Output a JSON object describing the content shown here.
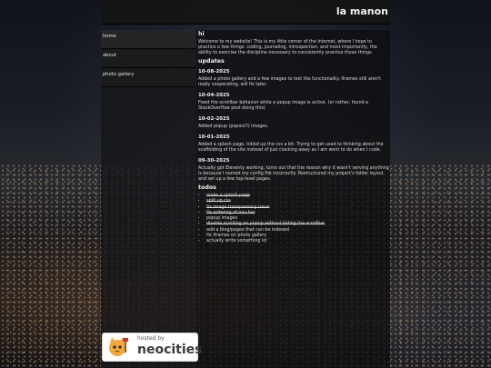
{
  "site": {
    "title": "la manon"
  },
  "nav": [
    {
      "label": "home"
    },
    {
      "label": "about"
    },
    {
      "label": "photo gallery"
    }
  ],
  "main": {
    "heading": "hi",
    "intro": "Welcome to my website! This is my little corner of the Internet, where I hope to practice a few things: coding, journaling, introspection, and most importantly, the ability to exercise the discipline necessary to consistently practice those things.",
    "updates_heading": "updates",
    "updates": [
      {
        "date": "10-08-2025",
        "text": "Added a photo gallery and a few images to test the functionality. Iframes still aren't really cooperating, will fix later."
      },
      {
        "date": "10-04-2025",
        "text": "Fixed the scrollbar behavior while a popup image is active. (or rather, found a StackOverflow post doing this)"
      },
      {
        "date": "10-02-2025",
        "text": "Added popup (popout?) images."
      },
      {
        "date": "10-01-2025",
        "text": "Added a splash page, tidied up the css a bit. Trying to get used to thinking about the scaffolding of the site instead of just clacking away as I am wont to do when I code."
      },
      {
        "date": "09-30-2025",
        "text": "Actually got Eleventy working, turns out that the reason why it wasn't serving anything is because I named my config file incorrectly. Restructured my project's folder layout and set up a few top-level pages."
      }
    ],
    "todos_heading": "todos",
    "todos": [
      {
        "text": "make a splash page",
        "done": true
      },
      {
        "text": "split up css",
        "done": true
      },
      {
        "text": "fix image transparency issue",
        "done": true
      },
      {
        "text": "fix ordering of nav bar",
        "done": true
      },
      {
        "text": "popup images",
        "done": false
      },
      {
        "text": "disable scrolling on popup without hiding the scrollbar",
        "done": true
      },
      {
        "text": "add a blog/pages that can be indexed",
        "done": false
      },
      {
        "text": "fix iframes on photo gallery",
        "done": false
      },
      {
        "text": "actually write something lol",
        "done": false
      }
    ]
  },
  "badge": {
    "line1": "hosted by",
    "line2": "neocities"
  }
}
